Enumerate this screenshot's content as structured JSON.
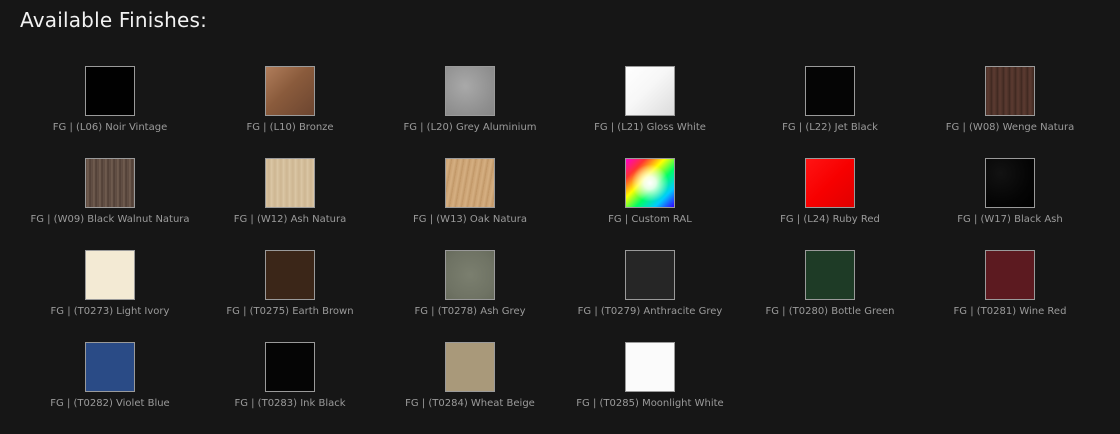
{
  "heading": "Available Finishes:",
  "finishes": [
    {
      "label": "FG | (L06) Noir Vintage",
      "swatch": "noir-vintage",
      "color": "#010101"
    },
    {
      "label": "FG | (L10) Bronze",
      "swatch": "bronze",
      "color": "#8a5b3c"
    },
    {
      "label": "FG | (L20) Grey Aluminium",
      "swatch": "grey-aluminium",
      "color": "#8f8f8f"
    },
    {
      "label": "FG | (L21) Gloss White",
      "swatch": "gloss-white",
      "color": "#f7f7f7"
    },
    {
      "label": "FG | (L22) Jet Black",
      "swatch": "jet-black",
      "color": "#050505"
    },
    {
      "label": "FG | (W08) Wenge Natura",
      "swatch": "wenge-natura",
      "color": "#4f332a"
    },
    {
      "label": "FG | (W09) Black Walnut Natura",
      "swatch": "black-walnut-natura",
      "color": "#5a473c"
    },
    {
      "label": "FG | (W12) Ash Natura",
      "swatch": "ash-natura",
      "color": "#d8c3a0"
    },
    {
      "label": "FG | (W13) Oak Natura",
      "swatch": "oak-natura",
      "color": "#c9a071"
    },
    {
      "label": "FG | Custom RAL",
      "swatch": "custom-ral",
      "color": "#ffffff"
    },
    {
      "label": "FG | (L24) Ruby Red",
      "swatch": "ruby-red",
      "color": "#f70000"
    },
    {
      "label": "FG | (W17) Black Ash",
      "swatch": "black-ash",
      "color": "#050505"
    },
    {
      "label": "FG | (T0273) Light Ivory",
      "swatch": "light-ivory",
      "color": "#f3ead4"
    },
    {
      "label": "FG | (T0275) Earth Brown",
      "swatch": "earth-brown",
      "color": "#3b2618"
    },
    {
      "label": "FG | (T0278) Ash Grey",
      "swatch": "ash-grey",
      "color": "#6f7364"
    },
    {
      "label": "FG | (T0279) Anthracite Grey",
      "swatch": "anthracite-grey",
      "color": "#262626"
    },
    {
      "label": "FG | (T0280) Bottle Green",
      "swatch": "bottle-green",
      "color": "#1e3b26"
    },
    {
      "label": "FG | (T0281) Wine Red",
      "swatch": "wine-red",
      "color": "#5c1a20"
    },
    {
      "label": "FG | (T0282) Violet Blue",
      "swatch": "violet-blue",
      "color": "#2a4b86"
    },
    {
      "label": "FG | (T0283) Ink Black",
      "swatch": "ink-black",
      "color": "#050505"
    },
    {
      "label": "FG | (T0284) Wheat Beige",
      "swatch": "wheat-beige",
      "color": "#a9997a"
    },
    {
      "label": "FG | (T0285) Moonlight White",
      "swatch": "moonlight-white",
      "color": "#fbfbfb"
    }
  ]
}
